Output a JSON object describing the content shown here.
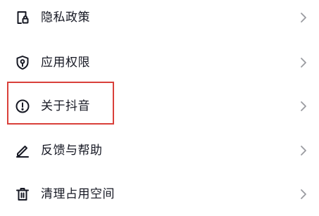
{
  "menu": {
    "items": [
      {
        "label": "隐私政策",
        "icon": "privacy-policy-icon"
      },
      {
        "label": "应用权限",
        "icon": "shield-icon"
      },
      {
        "label": "关于抖音",
        "icon": "info-circle-icon"
      },
      {
        "label": "反馈与帮助",
        "icon": "pencil-icon"
      },
      {
        "label": "清理占用空间",
        "icon": "trash-icon"
      }
    ],
    "chevron_icon": "chevron-right-icon"
  },
  "colors": {
    "text": "#161823",
    "icon": "#161823",
    "chevron": "#9a9ba0",
    "highlight": "#d9403a",
    "background": "#ffffff"
  }
}
